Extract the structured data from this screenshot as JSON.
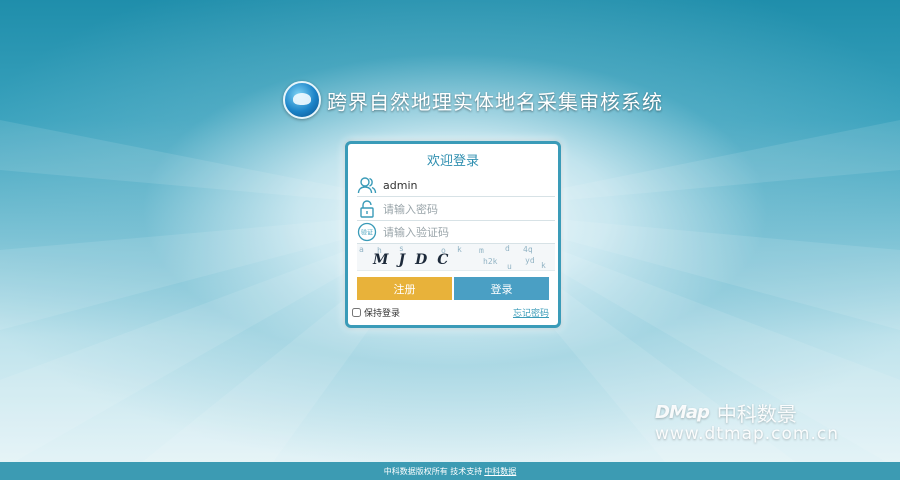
{
  "header": {
    "system_title": "跨界自然地理实体地名采集审核系统",
    "logo_icon": "globe-emblem-icon"
  },
  "login": {
    "title": "欢迎登录",
    "username": {
      "value": "admin",
      "icon": "user-icon"
    },
    "password": {
      "placeholder": "请输入密码",
      "icon": "lock-icon"
    },
    "captcha_input": {
      "placeholder": "请输入验证码",
      "icon": "captcha-icon",
      "icon_text": "验证"
    },
    "captcha_image": {
      "text": "MJDC"
    },
    "register_label": "注册",
    "login_label": "登录",
    "remember_label": "保持登录",
    "remember_checked": false,
    "forgot_label": "忘记密码"
  },
  "watermark": {
    "brand": "中科数景",
    "logo_text": "DMap",
    "url": "www.dtmap.com.cn"
  },
  "footer": {
    "text": "中科数据版权所有 技术支持",
    "link": "中科数据"
  },
  "colors": {
    "accent": "#3a9bb8",
    "register": "#e8b23a",
    "login": "#4a9fc4",
    "footer": "#3c9bb3"
  }
}
